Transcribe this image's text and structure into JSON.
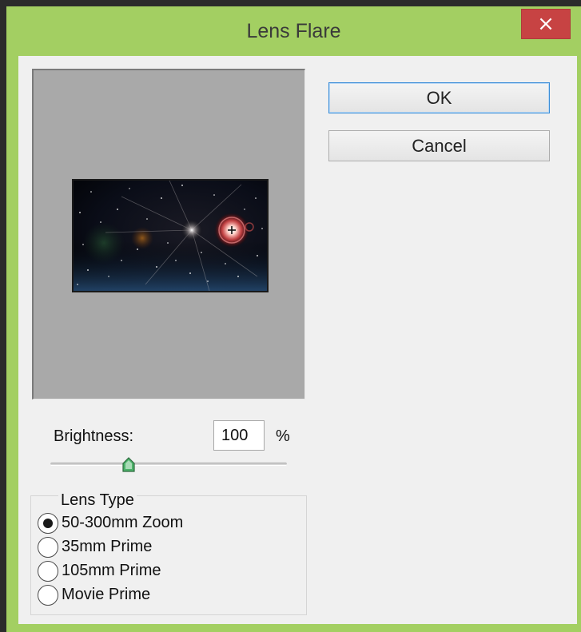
{
  "window": {
    "title": "Lens Flare",
    "close_glyph": "×"
  },
  "buttons": {
    "ok": "OK",
    "cancel": "Cancel"
  },
  "brightness": {
    "label": "Brightness:",
    "value": "100",
    "unit": "%",
    "slider_fraction": 0.33
  },
  "lens_type": {
    "legend": "Lens Type",
    "options": [
      {
        "label": "50-300mm Zoom",
        "selected": true
      },
      {
        "label": "35mm Prime",
        "selected": false
      },
      {
        "label": "105mm Prime",
        "selected": false
      },
      {
        "label": "Movie Prime",
        "selected": false
      }
    ]
  },
  "preview": {
    "icon": "crosshair-icon"
  },
  "colors": {
    "titlebar": "#a3cf62",
    "close": "#c74343",
    "client": "#f0f0f0",
    "preview_bg": "#a9a9a9",
    "focus": "#3c8ed8"
  }
}
